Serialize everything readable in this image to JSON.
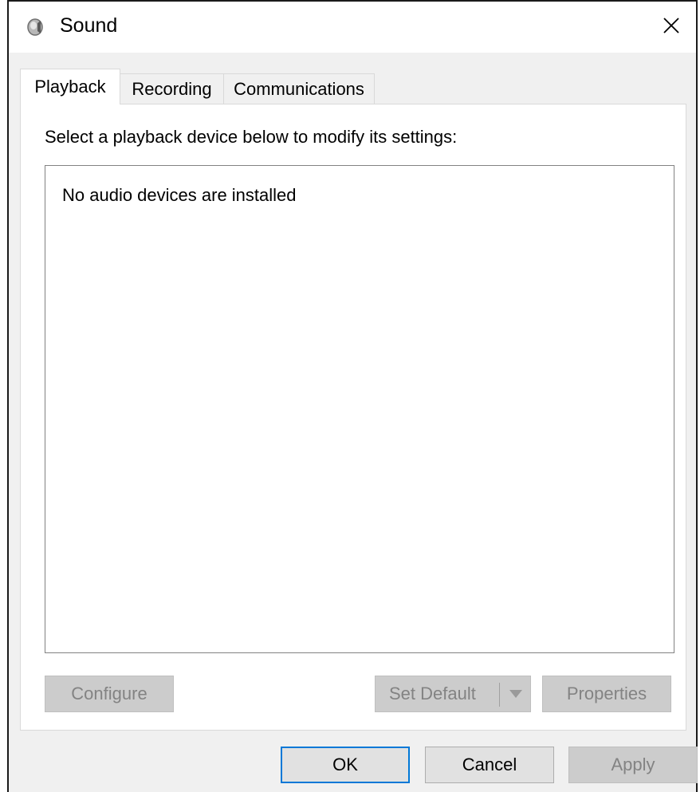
{
  "window": {
    "title": "Sound",
    "icons": {
      "app": "speaker-icon",
      "close": "close-icon"
    }
  },
  "tabs": [
    {
      "label": "Playback",
      "active": true
    },
    {
      "label": "Recording",
      "active": false
    },
    {
      "label": "Communications",
      "active": false
    }
  ],
  "playback": {
    "instruction": "Select a playback device below to modify its settings:",
    "empty_message": "No audio devices are installed",
    "configure_label": "Configure",
    "set_default_label": "Set Default",
    "properties_label": "Properties"
  },
  "footer": {
    "ok_label": "OK",
    "cancel_label": "Cancel",
    "apply_label": "Apply"
  },
  "colors": {
    "focus_accent": "#0078d7",
    "disabled_bg": "#cccccc",
    "disabled_text": "#838383"
  }
}
